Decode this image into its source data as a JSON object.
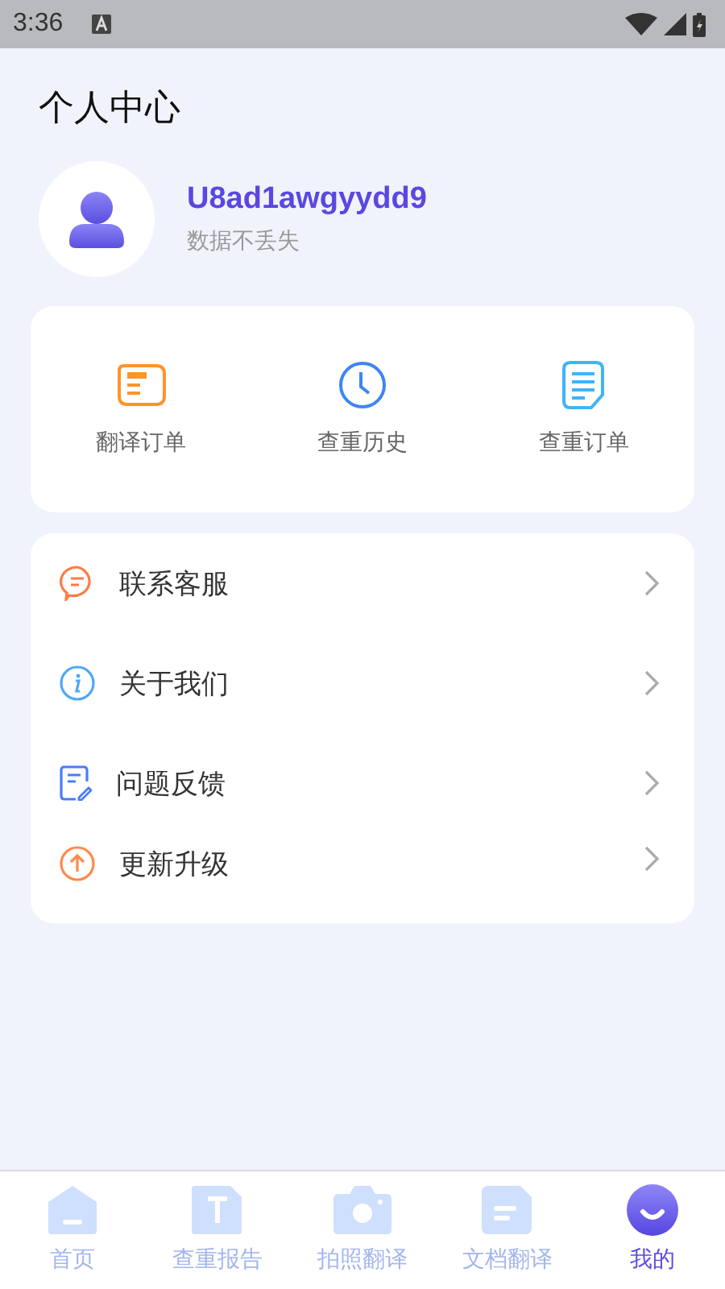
{
  "status_bar": {
    "time": "3:36"
  },
  "title": "个人中心",
  "profile": {
    "username": "U8ad1awgyydd9",
    "subtitle": "数据不丢失"
  },
  "shortcuts": [
    {
      "kind": "translate-order",
      "label": "翻译订单"
    },
    {
      "kind": "history",
      "label": "查重历史"
    },
    {
      "kind": "check-order",
      "label": "查重订单"
    }
  ],
  "menu": [
    {
      "kind": "service",
      "label": "联系客服"
    },
    {
      "kind": "about",
      "label": "关于我们"
    },
    {
      "kind": "feedback",
      "label": "问题反馈"
    },
    {
      "kind": "update",
      "label": "更新升级"
    }
  ],
  "tabs": [
    {
      "kind": "home",
      "label": "首页",
      "selected": false
    },
    {
      "kind": "report",
      "label": "查重报告",
      "selected": false
    },
    {
      "kind": "camera",
      "label": "拍照翻译",
      "selected": false
    },
    {
      "kind": "document",
      "label": "文档翻译",
      "selected": false
    },
    {
      "kind": "me",
      "label": "我的",
      "selected": true
    }
  ]
}
